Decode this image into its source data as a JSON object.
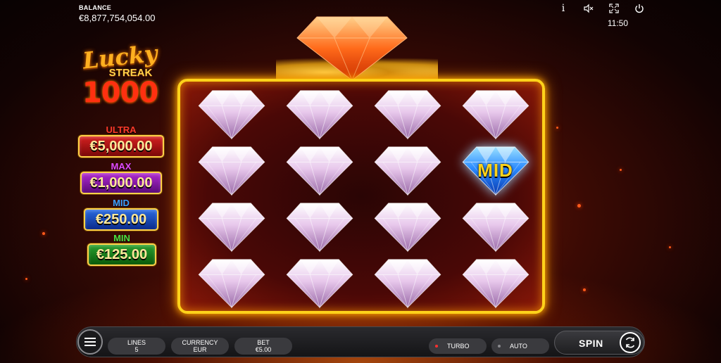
{
  "balance": {
    "label": "BALANCE",
    "value": "€8,877,754,054.00"
  },
  "top_controls": {
    "info_icon": "i",
    "clock": "11:50"
  },
  "logo": {
    "word1": "Lucky",
    "word2": "STREAK",
    "word3": "1000"
  },
  "jackpots": {
    "ultra": {
      "label": "ULTRA",
      "amount": "€5,000.00",
      "color": "#d42020"
    },
    "max": {
      "label": "MAX",
      "amount": "€1,000.00",
      "color": "#b02ad0"
    },
    "mid": {
      "label": "MID",
      "amount": "€250.00",
      "color": "#2a6ae0"
    },
    "min": {
      "label": "MIN",
      "amount": "€125.00",
      "color": "#2aa030"
    }
  },
  "reels": {
    "rows": 4,
    "cols": 4,
    "symbols": [
      [
        "pink-diamond",
        "pink-diamond",
        "pink-diamond",
        "pink-diamond"
      ],
      [
        "pink-diamond",
        "pink-diamond",
        "pink-diamond",
        "blue-mid-diamond"
      ],
      [
        "pink-diamond",
        "pink-diamond",
        "pink-diamond",
        "pink-diamond"
      ],
      [
        "pink-diamond",
        "pink-diamond",
        "pink-diamond",
        "pink-diamond"
      ]
    ],
    "mid_symbol_label": "MID"
  },
  "bottom_bar": {
    "lines": {
      "label": "LINES",
      "value": "5"
    },
    "currency": {
      "label": "CURRENCY",
      "value": "EUR"
    },
    "bet": {
      "label": "BET",
      "value": "€5.00"
    },
    "turbo": {
      "label": "TURBO",
      "active_color": "#ff3030"
    },
    "auto": {
      "label": "AUTO"
    },
    "spin": {
      "label": "SPIN"
    }
  },
  "colors": {
    "frame": "#ffd21a",
    "background": "#3a0a04"
  }
}
